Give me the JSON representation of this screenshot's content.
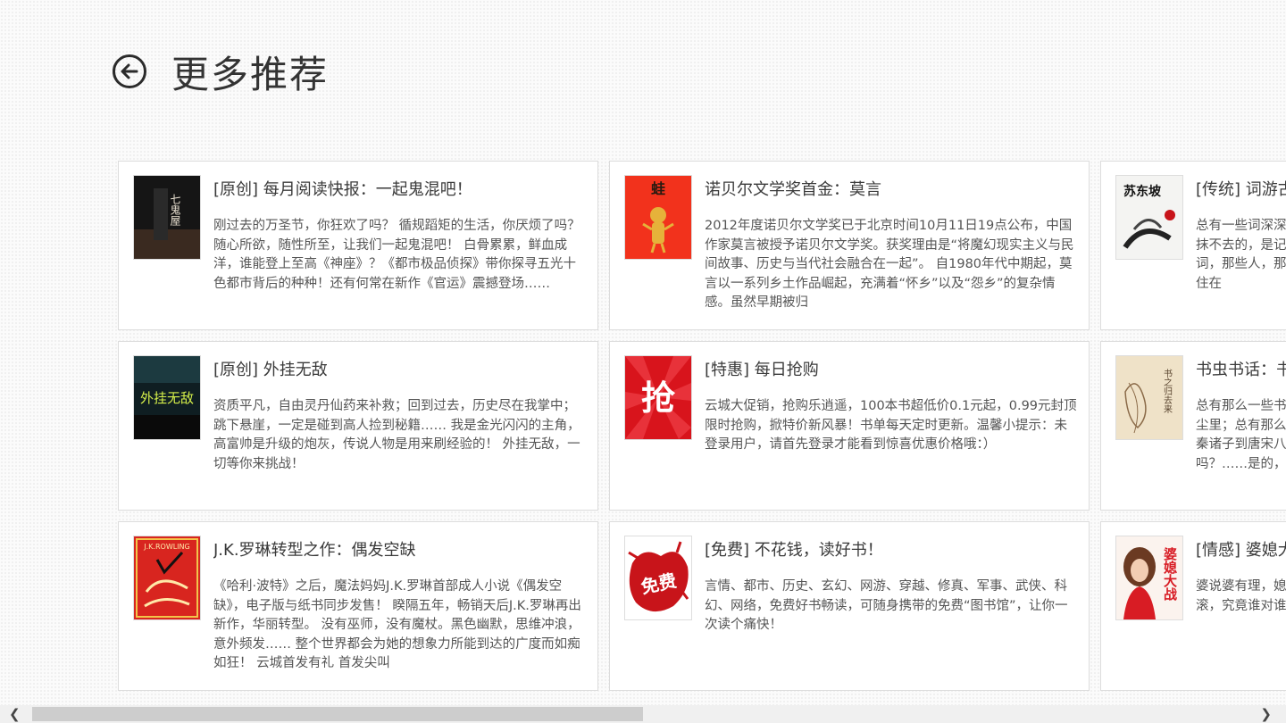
{
  "header": {
    "title": "更多推荐"
  },
  "cards": [
    {
      "title": "[原创] 每月阅读快报：一起鬼混吧！",
      "desc": "刚过去的万圣节，你狂欢了吗？ 循规蹈矩的生活，你厌烦了吗？ 随心所欲，随性所至，让我们一起鬼混吧！ 白骨累累，鲜血成洋，谁能登上至高《神座》？《都市极品侦探》带你探寻五光十色都市背后的种种！还有何常在新作《官运》震撼登场……",
      "cover_text": "七鬼屋"
    },
    {
      "title": "诺贝尔文学奖首金：莫言",
      "desc": "2012年度诺贝尔文学奖已于北京时间10月11日19点公布，中国作家莫言被授予诺贝尔文学奖。获奖理由是“将魔幻现实主义与民间故事、历史与当代社会融合在一起”。 自1980年代中期起，莫言以一系列乡土作品崛起，充满着“怀乡”以及“怨乡”的复杂情感。虽然早期被归",
      "cover_text": "蛙"
    },
    {
      "title": "[传统] 词游古代",
      "desc": "总有一些词深深刻在心底，那些词的背后，隐藏着怎样的隐情？抹不去的，是记忆；流转在词里，感受字里行间的情怀。那些词，那些人，那些铮铮骨骼心经历浮沉；那些看不见的传奇就是住在",
      "cover_text": "苏东坡"
    },
    {
      "title": "[原创] 外挂无敌",
      "desc": "资质平凡，自由灵丹仙药来补救；回到过去，历史尽在我掌中；跳下悬崖，一定是碰到高人捡到秘籍…… 我是金光闪闪的主角，高富帅是升级的炮灰，传说人物是用来刷经验的！ 外挂无敌，一切等你来挑战！",
      "cover_text": "外挂无敌"
    },
    {
      "title": "[特惠] 每日抢购",
      "desc": "云城大促销，抢购乐逍遥，100本书超低价0.1元起，0.99元封顶限时抢购，掀特价新风暴！书单每天定时更新。温馨小提示：未登录用户，请首先登录才能看到惊喜优惠价格哦：）",
      "cover_text": "抢"
    },
    {
      "title": "书虫书话：书之归去来",
      "desc": "总有那么一些书，它们历经岁月，依然静静地躺在书馆厚厚的灰尘里；总有那么一些人，他们阅读着这个伟大的阅读时代。从先秦诸子到唐宋八大家，编书删诗的孔子，你是否真正读懂了他们吗？……是的，",
      "cover_text": "书之归去来"
    },
    {
      "title": "J.K.罗琳转型之作：偶发空缺",
      "desc": "《哈利·波特》之后，魔法妈妈J.K.罗琳首部成人小说《偶发空缺》，电子版与纸书同步发售！ 睽隔五年，畅销天后J.K.罗琳再出新作，华丽转型。 没有巫师，没有魔杖。黑色幽默，思维冲浪，意外频发…… 整个世界都会为她的想象力所能到达的广度而如痴如狂！ 云城首发有礼 首发尖叫",
      "cover_text": "J.K.ROWLING"
    },
    {
      "title": "[免费] 不花钱，读好书！",
      "desc": "言情、都市、历史、玄幻、网游、穿越、修真、军事、武侠、科幻、网络，免费好书畅读，可随身携带的免费“图书馆”，让你一次读个痛快！",
      "cover_text": "免费"
    },
    {
      "title": "[情感] 婆媳大战",
      "desc": "婆说婆有理，媳说媳有理，婆媳之间的战争，鸡飞狗跳、天雷滚滚，究竟谁对谁错？婆媳之间如何相处才能融融一家亲？",
      "cover_text": "婆媳大战"
    }
  ]
}
